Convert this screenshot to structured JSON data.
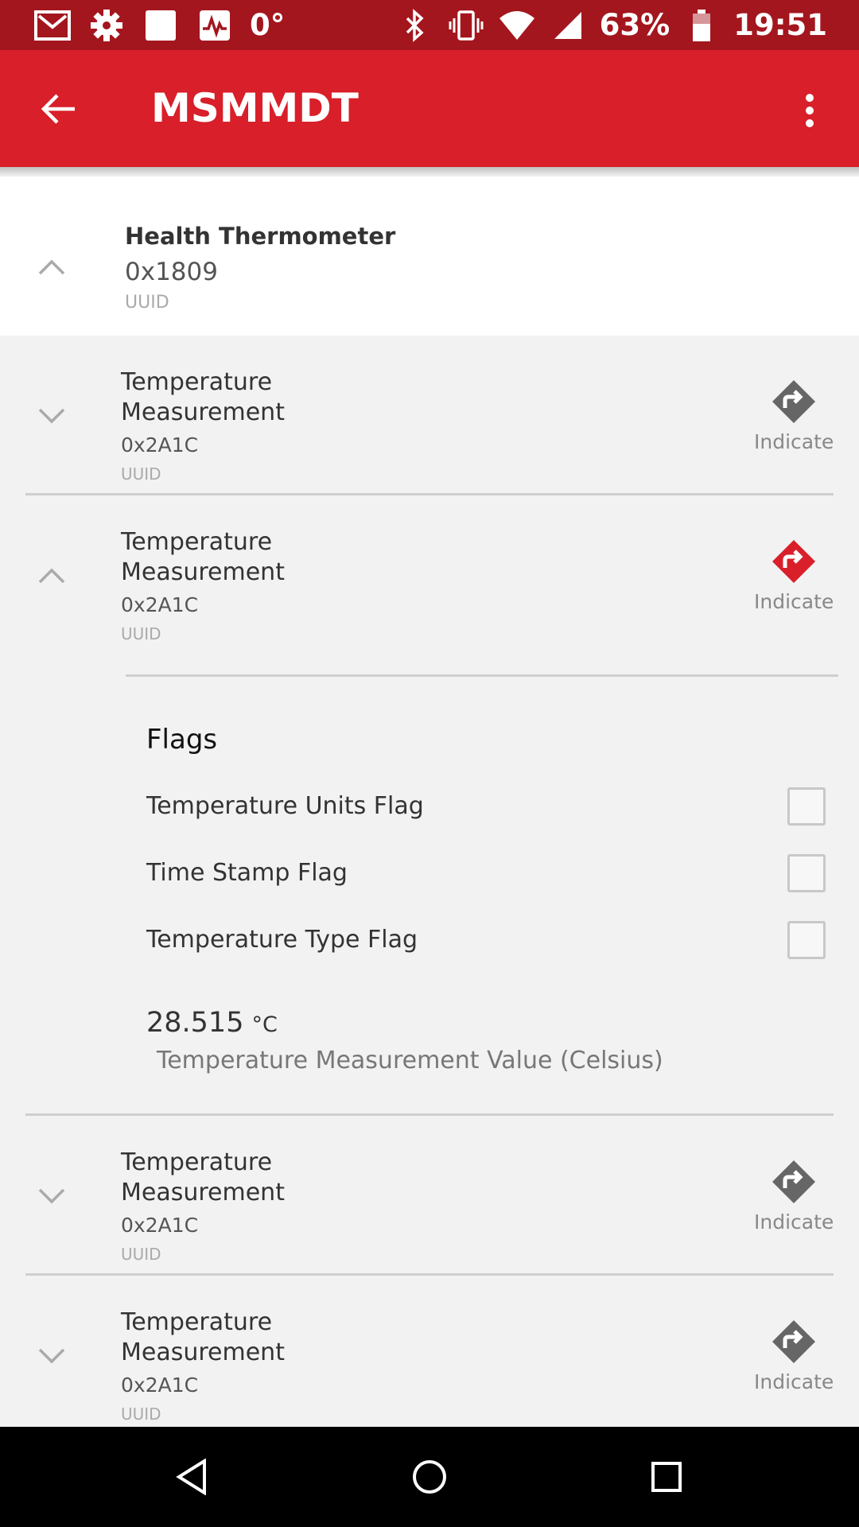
{
  "status_bar": {
    "temperature": "0°",
    "battery": "63%",
    "time": "19:51"
  },
  "app_bar": {
    "title": "MSMMDT"
  },
  "service": {
    "name": "Health Thermometer",
    "uuid": "0x1809",
    "uuid_label": "UUID"
  },
  "characteristics": [
    {
      "name": "Temperature Measurement",
      "uuid": "0x2A1C",
      "uuid_label": "UUID",
      "action": "Indicate",
      "expanded": false,
      "active": false
    },
    {
      "name": "Temperature Measurement",
      "uuid": "0x2A1C",
      "uuid_label": "UUID",
      "action": "Indicate",
      "expanded": true,
      "active": true
    },
    {
      "name": "Temperature Measurement",
      "uuid": "0x2A1C",
      "uuid_label": "UUID",
      "action": "Indicate",
      "expanded": false,
      "active": false
    },
    {
      "name": "Temperature Measurement",
      "uuid": "0x2A1C",
      "uuid_label": "UUID",
      "action": "Indicate",
      "expanded": false,
      "active": false
    }
  ],
  "details": {
    "flags_title": "Flags",
    "flags": [
      {
        "label": "Temperature Units Flag",
        "checked": false
      },
      {
        "label": "Time Stamp Flag",
        "checked": false
      },
      {
        "label": "Temperature Type Flag",
        "checked": false
      }
    ],
    "value": "28.515",
    "unit": "°C",
    "value_label": "Temperature Measurement Value (Celsius)"
  },
  "colors": {
    "status_bar": "#a3161e",
    "app_bar": "#d81f2a",
    "indicate_active": "#d81f2a",
    "indicate_inactive": "#666666"
  },
  "icons": {
    "back": "arrow-left-icon",
    "overflow": "more-vert-icon",
    "indicate": "diamond-arrow-icon"
  }
}
